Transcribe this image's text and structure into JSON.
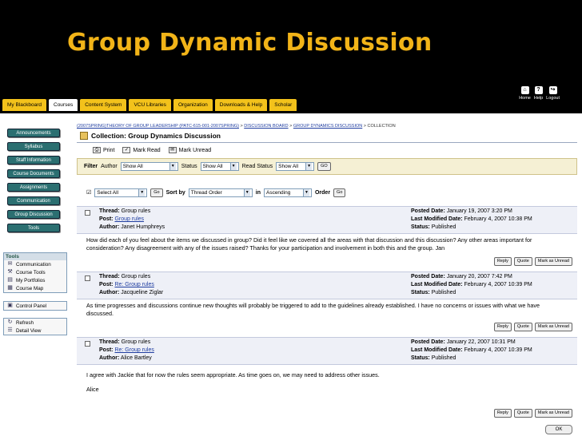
{
  "slide": {
    "title": "Group Dynamic Discussion"
  },
  "nav": {
    "tabs": [
      "My Blackboard",
      "Courses",
      "Content System",
      "VCU Libraries",
      "Organization",
      "Downloads & Help",
      "Scholar"
    ],
    "active_tab": "Courses",
    "utility": [
      {
        "label": "Home",
        "icon": "home-icon"
      },
      {
        "label": "Help",
        "icon": "help-icon"
      },
      {
        "label": "Logout",
        "icon": "logout-icon"
      }
    ]
  },
  "sidebar": {
    "course_buttons": [
      "Announcements",
      "Syllabus",
      "Staff Information",
      "Course Documents",
      "Assignments",
      "Communication",
      "Group Discussion",
      "Tools"
    ],
    "tools_box": {
      "title": "Tools",
      "items": [
        {
          "label": "Communication",
          "icon": "communication-icon"
        },
        {
          "label": "Course Tools",
          "icon": "course-tools-icon"
        },
        {
          "label": "My Portfolios",
          "icon": "portfolios-icon"
        },
        {
          "label": "Course Map",
          "icon": "course-map-icon"
        }
      ]
    },
    "control_box": {
      "items": [
        {
          "label": "Control Panel",
          "icon": "control-panel-icon"
        }
      ]
    },
    "refresh_box": {
      "items": [
        {
          "label": "Refresh",
          "icon": "refresh-icon"
        },
        {
          "label": "Detail View",
          "icon": "detail-view-icon"
        }
      ]
    }
  },
  "breadcrumb": {
    "course": "(2007SPRING)THEORY OF GROUP LEADERSHIP (PATC-615-001-2007SPRING)",
    "board": "DISCUSSION BOARD",
    "forum": "GROUP DYNAMICS DISCUSSION",
    "current": "COLLECTION"
  },
  "page_heading": "Collection: Group Dynamics Discussion",
  "actions": [
    "Print",
    "Mark Read",
    "Mark Unread"
  ],
  "filter": {
    "label": "Filter",
    "author_label": "Author",
    "author_value": "Show All",
    "status_label": "Status",
    "status_value": "Show All",
    "read_status_label": "Read Status",
    "read_status_value": "Show All",
    "go": "GO"
  },
  "sort": {
    "select_value": "Select All",
    "go": "Go",
    "sort_by_label": "Sort by",
    "sort_value": "Thread Order",
    "in_label": "in",
    "order_value": "Ascending",
    "order_label": "Order",
    "order_go": "Go"
  },
  "posts": [
    {
      "thread": "Group rules",
      "post": "Group rules",
      "author": "Janet Humphreys",
      "posted_date": "January 19, 2007 3:20 PM",
      "last_modified": "February 4, 2007 10:38 PM",
      "status": "Published",
      "body": "How did each of you feel about the items we discussed in group? Did it feel like we covered all the areas with that discussion and this discussion? Any other areas important for consideration? Any disagreement with any of the issues raised? Thanks for your participation and involvement in both this and the group.  Jan",
      "body2": ""
    },
    {
      "thread": "Group rules",
      "post": "Re: Group rules",
      "author": "Jacqueline Ziglar",
      "posted_date": "January 20, 2007 7:42 PM",
      "last_modified": "February 4, 2007 10:39 PM",
      "status": "Published",
      "body": "As time progresses and discussions continue new thoughts will probably be triggered to add to the guidelines already established. I have no concerns or issues with what we have discussed.",
      "body2": ""
    },
    {
      "thread": "Group rules",
      "post": "Re: Group rules",
      "author": "Alice Bartley",
      "posted_date": "January 22, 2007 10:31 PM",
      "last_modified": "February 4, 2007 10:39 PM",
      "status": "Published",
      "body": "I agree with Jackie that for now the rules seem appropriate.  As time goes on, we may need to address other issues.",
      "body2": "Alice"
    }
  ],
  "labels": {
    "thread": "Thread:",
    "post": "Post:",
    "author": "Author:",
    "posted_date": "Posted Date:",
    "last_modified": "Last Modified Date:",
    "status": "Status:",
    "reply": "Reply",
    "quote": "Quote",
    "mark_unread": "Mark as Unread",
    "ok": "OK"
  }
}
